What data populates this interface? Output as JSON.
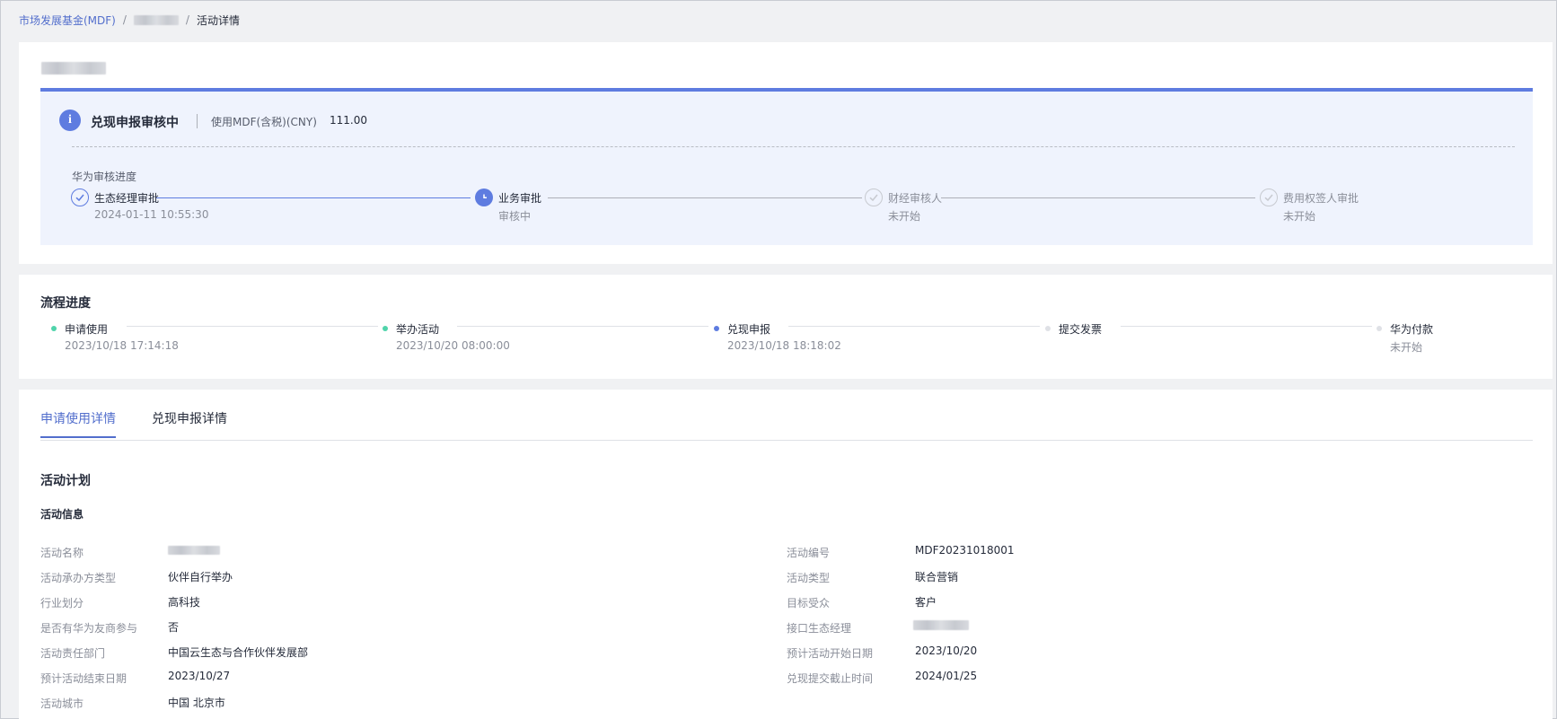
{
  "breadcrumb": {
    "root": "市场发展基金(MDF)",
    "current": "活动详情"
  },
  "status": {
    "title": "兑现申报审核中",
    "amount_label": "使用MDF(含税)(CNY)",
    "amount_value": "111.00",
    "review_label": "华为审核进度",
    "steps": [
      {
        "label": "生态经理审批",
        "sub": "2024-01-11 10:55:30",
        "state": "done"
      },
      {
        "label": "业务审批",
        "sub": "审核中",
        "state": "active"
      },
      {
        "label": "财经审核人",
        "sub": "未开始",
        "state": "pending"
      },
      {
        "label": "费用权签人审批",
        "sub": "未开始",
        "state": "pending"
      }
    ]
  },
  "flow": {
    "title": "流程进度",
    "steps": [
      {
        "label": "申请使用",
        "sub": "2023/10/18 17:14:18",
        "color": "#50d4ab"
      },
      {
        "label": "举办活动",
        "sub": "2023/10/20 08:00:00",
        "color": "#50d4ab"
      },
      {
        "label": "兑现申报",
        "sub": "2023/10/18 18:18:02",
        "color": "#5e7ce0"
      },
      {
        "label": "提交发票",
        "sub": "",
        "color": "#dfe1e6"
      },
      {
        "label": "华为付款",
        "sub": "未开始",
        "color": "#dfe1e6"
      }
    ]
  },
  "tabs": [
    {
      "label": "申请使用详情",
      "active": true
    },
    {
      "label": "兑现申报详情",
      "active": false
    }
  ],
  "plan": {
    "title": "活动计划",
    "info_title": "活动信息",
    "left_fields": [
      {
        "label": "活动名称",
        "value": ""
      },
      {
        "label": "活动承办方类型",
        "value": "伙伴自行举办"
      },
      {
        "label": "行业划分",
        "value": "高科技"
      },
      {
        "label": "是否有华为友商参与",
        "value": "否"
      },
      {
        "label": "活动责任部门",
        "value": "中国云生态与合作伙伴发展部"
      },
      {
        "label": "预计活动结束日期",
        "value": "2023/10/27"
      },
      {
        "label": "活动城市",
        "value": "中国 北京市"
      }
    ],
    "right_fields": [
      {
        "label": "活动编号",
        "value": "MDF20231018001"
      },
      {
        "label": "活动类型",
        "value": "联合营销"
      },
      {
        "label": "目标受众",
        "value": "客户"
      },
      {
        "label": "接口生态经理",
        "value": ""
      },
      {
        "label": "预计活动开始日期",
        "value": "2023/10/20"
      },
      {
        "label": "兑现提交截止时间",
        "value": "2024/01/25"
      }
    ]
  },
  "colors": {
    "accent": "#5e7ce0",
    "success": "#50d4ab",
    "pending": "#dfe1e6"
  }
}
